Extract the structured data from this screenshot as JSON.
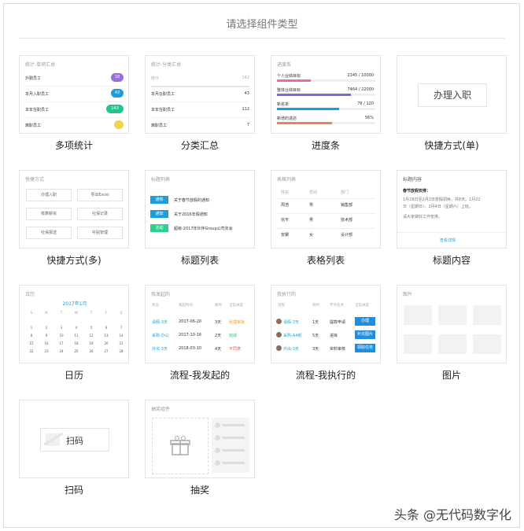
{
  "title": "请选择组件类型",
  "cards": {
    "c1": {
      "label": "多项统计",
      "title": "统计-单项汇总",
      "rows": [
        {
          "n": "外勤员工",
          "v": "18",
          "c": "#9b6ddb"
        },
        {
          "n": "本月入职员工",
          "v": "43",
          "c": "#1e9ed8"
        },
        {
          "n": "本年在职员工",
          "v": "143",
          "c": "#22c68a"
        },
        {
          "n": "离职员工",
          "v": "",
          "c": "#f6d34a"
        }
      ]
    },
    "c2": {
      "label": "分类汇总",
      "title": "统计-分类汇总",
      "head": {
        "n": "统计",
        "v": "142"
      },
      "rows": [
        {
          "n": "本月在职员工",
          "v": "43"
        },
        {
          "n": "本年在职员工",
          "v": "112"
        },
        {
          "n": "离职员工",
          "v": "7"
        }
      ]
    },
    "c3": {
      "label": "进度条",
      "title": "进度条",
      "rows": [
        {
          "n": "个人业绩目标",
          "v": "2345",
          "t": "10000",
          "c": "#f06a9a",
          "p": 0.34
        },
        {
          "n": "整体业绩目标",
          "v": "7464",
          "t": "22000",
          "c": "#6e6fd6",
          "p": 0.75
        },
        {
          "n": "新名单",
          "v": "76",
          "t": "120",
          "c": "#1e9ed8",
          "p": 0.63
        },
        {
          "n": "新增的进店",
          "v": "56%",
          "t": "",
          "c": "#ef7f5a",
          "p": 0.56
        }
      ]
    },
    "c4": {
      "label": "快捷方式(单)",
      "button": "办理入职"
    },
    "c5": {
      "label": "快捷方式(多)",
      "title": "快捷方式",
      "buttons": [
        "办理入职",
        "导出Excel",
        "核算薪资",
        "社保记录",
        "社保报送",
        "补贴管理"
      ]
    },
    "c6": {
      "label": "标题列表",
      "title": "标题列表",
      "items": [
        {
          "tag": "通知",
          "c": "#1e9ed8",
          "t": "关于春节放假的通知"
        },
        {
          "tag": "通知",
          "c": "#1e9ed8",
          "t": "关于2016年假通知"
        },
        {
          "tag": "活动",
          "c": "#2fcf8e",
          "t": "超级-2017年伙伴Group公司年会"
        }
      ]
    },
    "c7": {
      "label": "表格列表",
      "title": "表格列表",
      "headers": [
        "姓名",
        "性别",
        "部门"
      ],
      "rows": [
        [
          "周浩",
          "男",
          "销售部"
        ],
        [
          "信平",
          "男",
          "技术部"
        ],
        [
          "安娜",
          "女",
          "设计部"
        ]
      ]
    },
    "c8": {
      "label": "标题内容",
      "title": "标题内容",
      "subject": "春节放假安排：",
      "body1": "1月26日至2月2日放假调休，共8天。1月22",
      "body2": "日（星期日）、2月4日（星期六）上班。",
      "body3": "请大家做好工作安排。",
      "link": "查看详情"
    },
    "c9": {
      "label": "日历",
      "title": "日历",
      "month": "2017年1月",
      "weekdays": [
        "S",
        "M",
        "T",
        "W",
        "T",
        "F",
        "S"
      ],
      "days": [
        "",
        "",
        "",
        "",
        "",
        "",
        "",
        "1",
        "2",
        "3",
        "4",
        "5",
        "6",
        "7",
        "8",
        "9",
        "10",
        "11",
        "12",
        "13",
        "14",
        "15",
        "16",
        "17",
        "18",
        "19",
        "20",
        "21",
        "22",
        "23",
        "24",
        "25",
        "26",
        "27",
        "28"
      ]
    },
    "c10": {
      "label": "流程-我发起的",
      "title": "我发起的",
      "headers": [
        "状态",
        "发起时间",
        "耗时",
        "当前进度"
      ],
      "rows": [
        {
          "a": "请假-3天",
          "b": "2017-06-20",
          "c": "3天",
          "d": "经理审批",
          "dc": "#f0a020"
        },
        {
          "a": "采购-办公",
          "b": "2017-10-16",
          "c": "2天",
          "d": "完成",
          "dc": "#2fbf6f"
        },
        {
          "a": "外出-3天",
          "b": "2018-03-10",
          "c": "4天",
          "d": "不同意",
          "dc": "#e05050"
        }
      ]
    },
    "c11": {
      "label": "流程-我执行的",
      "title": "我执行的",
      "headers": [
        "流程",
        "耗时",
        "节点任务",
        "当前进度"
      ],
      "rows": [
        {
          "a": "请假-3天",
          "b": "1天",
          "c": "提款申请",
          "d": "办理"
        },
        {
          "a": "采购-A4纸",
          "b": "5天",
          "c": "进库",
          "d": "补充图片"
        },
        {
          "a": "外出-3天",
          "b": "3天",
          "c": "资料审核",
          "d": "领取任务"
        }
      ]
    },
    "c12": {
      "label": "图片",
      "title": "图片"
    },
    "c13": {
      "label": "扫码",
      "button": "扫码"
    },
    "c14": {
      "label": "抽奖",
      "title": "抽奖组件"
    }
  },
  "watermark": "头条 @无代码数字化"
}
